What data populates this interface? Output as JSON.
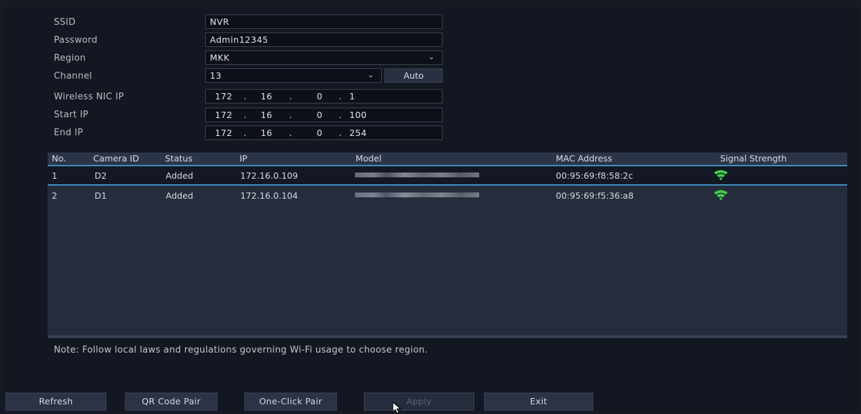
{
  "form": {
    "ssid": {
      "label": "SSID",
      "value": "NVR"
    },
    "password": {
      "label": "Password",
      "value": "Admin12345"
    },
    "region": {
      "label": "Region",
      "value": "MKK"
    },
    "channel": {
      "label": "Channel",
      "value": "13",
      "auto_label": "Auto"
    },
    "nic_ip": {
      "label": "Wireless NIC IP",
      "octets": [
        "172",
        "16",
        "0",
        "1"
      ]
    },
    "start_ip": {
      "label": "Start IP",
      "octets": [
        "172",
        "16",
        "0",
        "100"
      ]
    },
    "end_ip": {
      "label": "End IP",
      "octets": [
        "172",
        "16",
        "0",
        "254"
      ]
    }
  },
  "table": {
    "headers": {
      "no": "No.",
      "camera_id": "Camera ID",
      "status": "Status",
      "ip": "IP",
      "model": "Model",
      "mac": "MAC Address",
      "signal": "Signal Strength"
    },
    "rows": [
      {
        "no": "1",
        "camera_id": "D2",
        "status": "Added",
        "ip": "172.16.0.109",
        "mac": "00:95:69:f8:58:2c",
        "signal_icon": "wifi-signal-icon",
        "signal_color": "#3fcf4a",
        "selected": true
      },
      {
        "no": "2",
        "camera_id": "D1",
        "status": "Added",
        "ip": "172.16.0.104",
        "mac": "00:95:69:f5:36:a8",
        "signal_icon": "wifi-signal-icon",
        "signal_color": "#3fcf4a",
        "selected": false
      }
    ]
  },
  "note": "Note: Follow local laws and regulations governing Wi-Fi usage to choose region.",
  "buttons": {
    "refresh": "Refresh",
    "qr_pair": "QR Code Pair",
    "one_click": "One-Click Pair",
    "apply": "Apply",
    "exit": "Exit"
  },
  "colors": {
    "accent": "#3d8fc2",
    "signal": "#3fcf4a"
  }
}
